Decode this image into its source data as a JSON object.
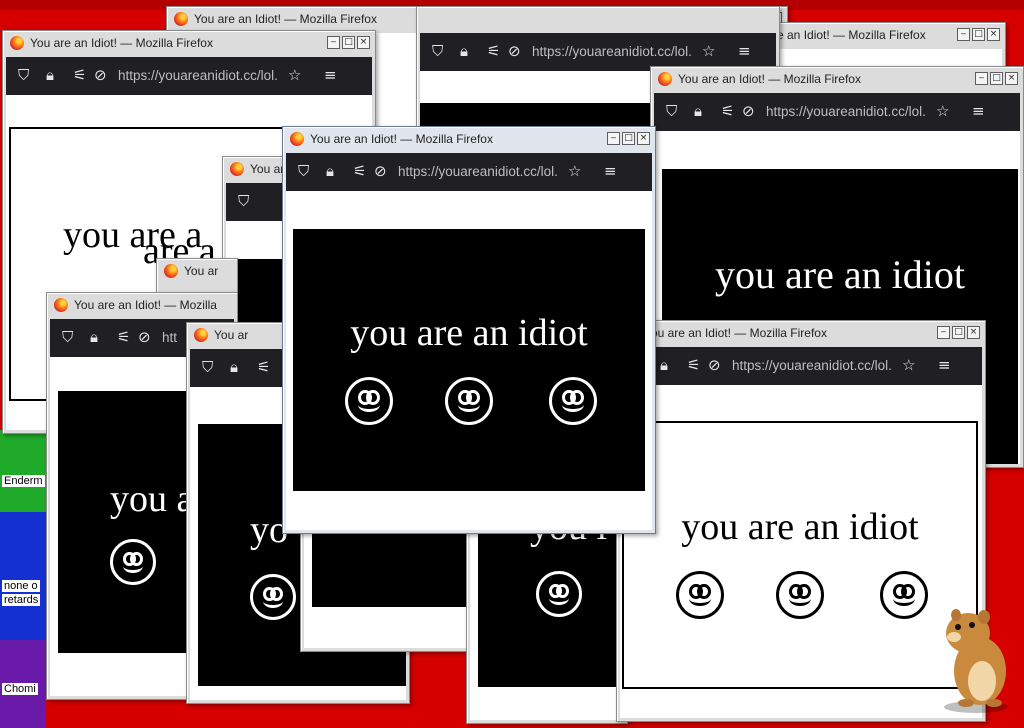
{
  "window_title": "You are an Idiot! — Mozilla Firefox",
  "window_title_short": "You are an Idiot! — Mozilla",
  "window_title_clipped": "You ar",
  "window_title_tail": "e an Idiot! — Mozilla Firefox",
  "url": "https://youareanidiot.cc/lol.",
  "url_short": "htt",
  "page_text": "you are an idiot",
  "page_text_clip_a": "you are a",
  "page_text_clip_b": "are a",
  "page_text_clip_c": "you a",
  "page_text_clip_d": "yo",
  "page_text_clip_e": "you i",
  "desktop_icons": [
    {
      "label": "Enderm"
    },
    {
      "label": "none o"
    },
    {
      "label": "retards"
    },
    {
      "label": "Chomi"
    }
  ],
  "icons": {
    "shield": "shield-icon",
    "lock": "lock-icon",
    "permissions": "permissions-icon",
    "tracking": "tracking-protection-icon",
    "star": "bookmark-star-icon",
    "menu": "hamburger-menu-icon",
    "minimize": "minimize-icon",
    "maximize": "maximize-icon",
    "close": "close-icon"
  },
  "colors": {
    "desktop": "#d60000",
    "navbar": "#202024",
    "panel_black": "#000000",
    "panel_white": "#ffffff"
  }
}
